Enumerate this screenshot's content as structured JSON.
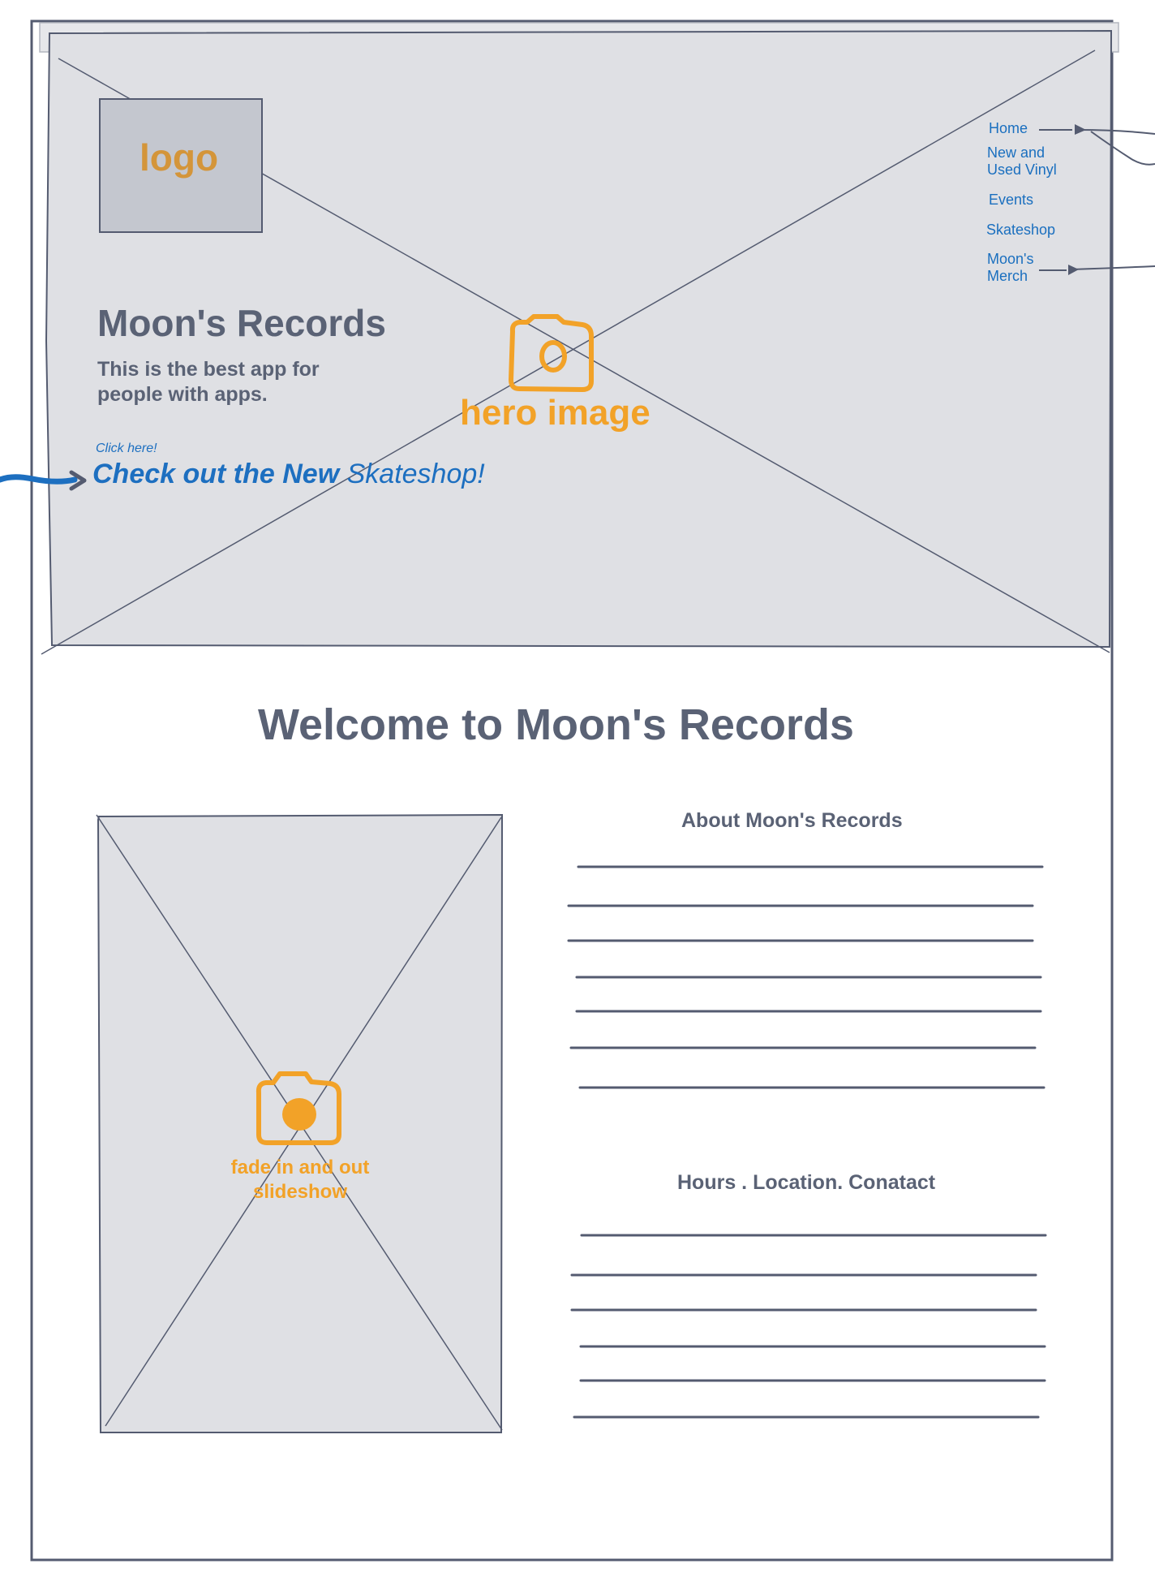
{
  "header": {
    "logo_label": "logo",
    "brand_title": "Moon's Records",
    "tagline": "This is the best app for people with apps.",
    "click_hint": "Click here!",
    "cta_bold": "Check out the New",
    "cta_rest": " Skateshop!",
    "hero_label": "hero image"
  },
  "nav": {
    "items": [
      {
        "label": "Home"
      },
      {
        "label": "New and Used Vinyl"
      },
      {
        "label": "Events"
      },
      {
        "label": "Skateshop"
      },
      {
        "label": "Moon's Merch"
      }
    ]
  },
  "main": {
    "welcome_title": "Welcome to Moon's Records",
    "slideshow_label": "fade in and out slideshow",
    "about_title": "About Moon's Records",
    "contact_title": "Hours . Location. Conatact"
  },
  "colors": {
    "placeholder_fill": "#dfe0e4",
    "outline": "#545b70",
    "accent_orange": "#f2a228",
    "link_blue": "#1a6fbf"
  }
}
